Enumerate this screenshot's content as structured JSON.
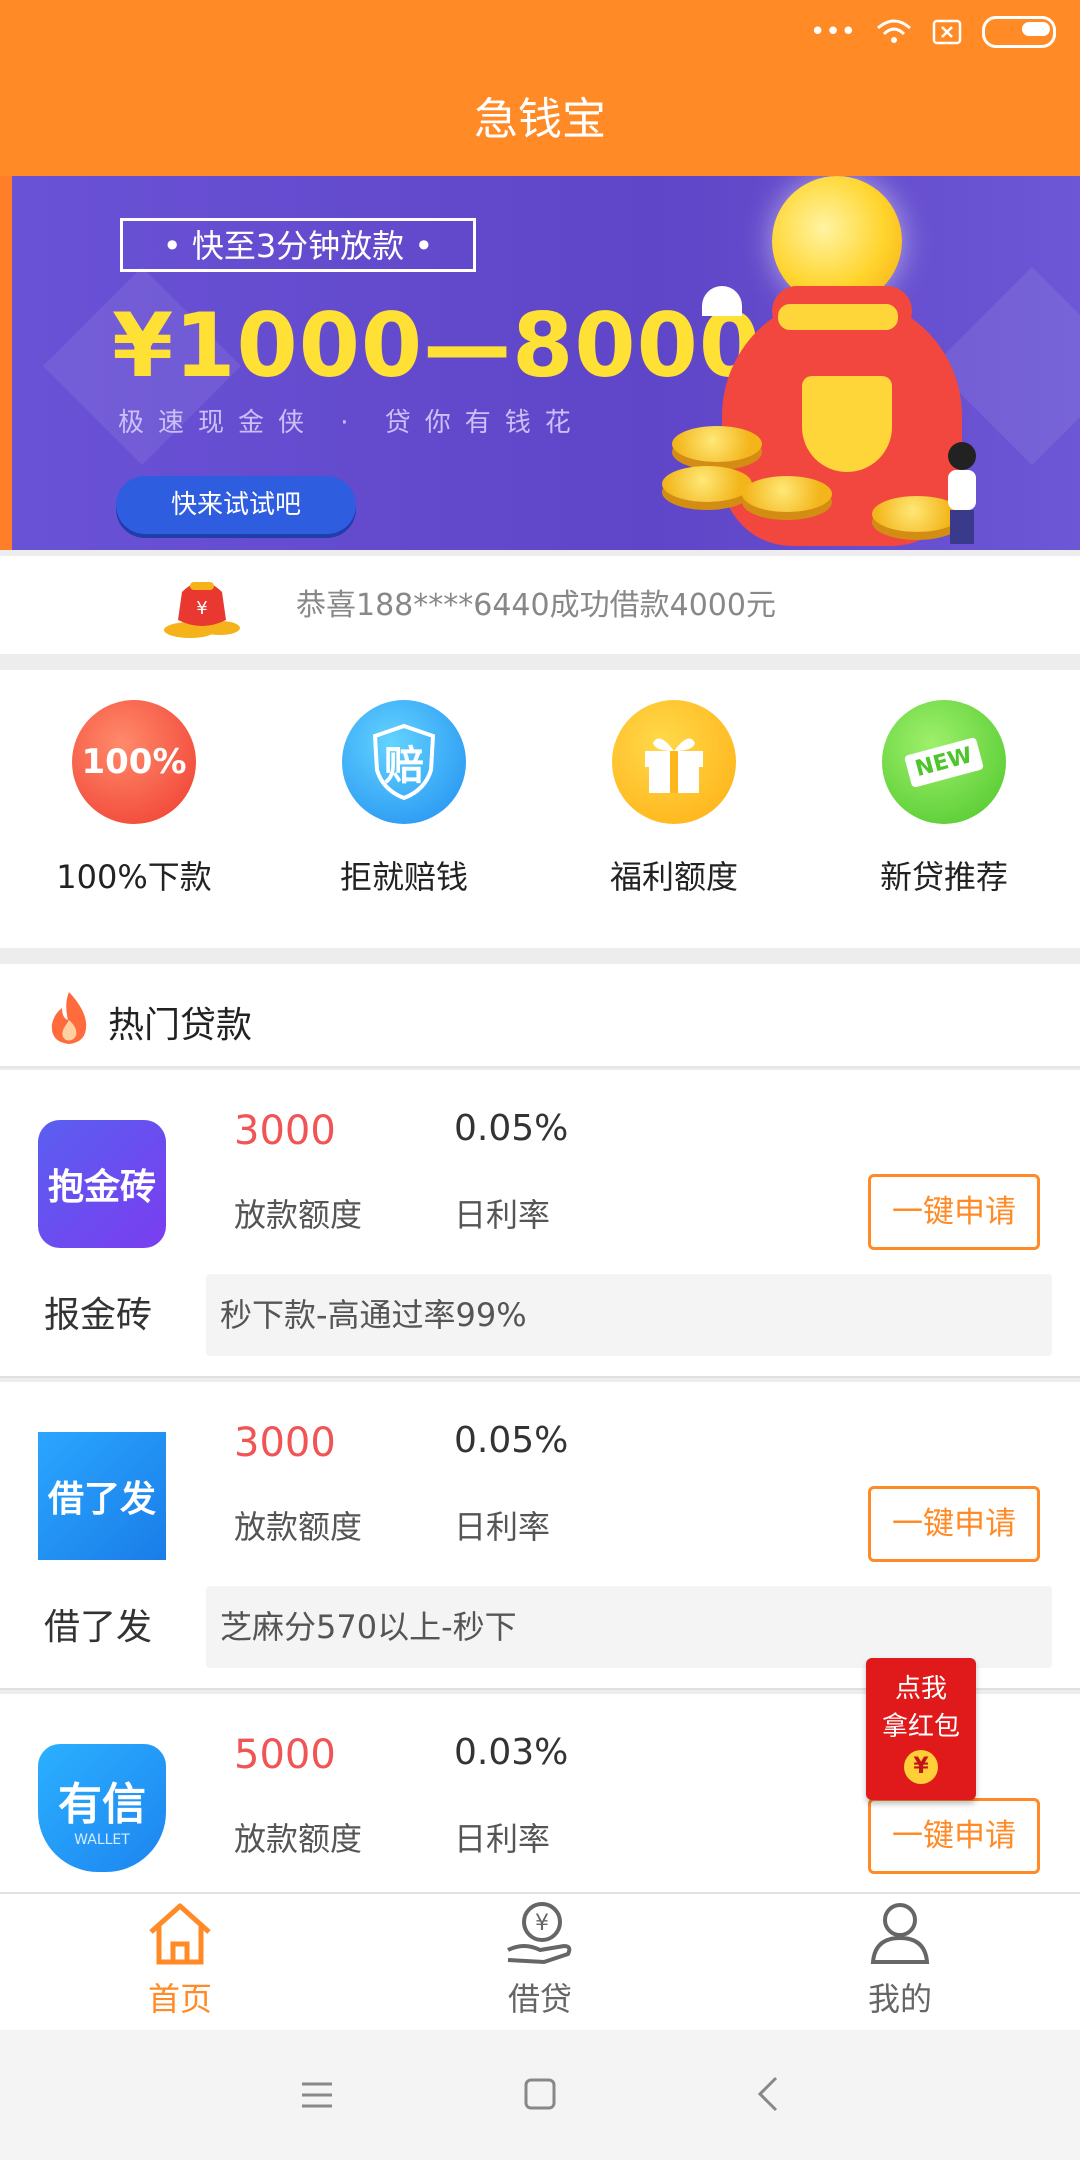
{
  "header": {
    "title": "急钱宝"
  },
  "banner": {
    "tagline": "• 快至3分钟放款 •",
    "amount": "¥1000—8000",
    "slogan": "极速现金侠 · 贷你有钱花",
    "cta": "快来试试吧"
  },
  "notice": {
    "text": "恭喜188****6440成功借款4000元"
  },
  "features": [
    {
      "label": "100%下款",
      "icon_text": "100%"
    },
    {
      "label": "拒就赔钱",
      "icon_text": "赔"
    },
    {
      "label": "福利额度"
    },
    {
      "label": "新贷推荐",
      "icon_text": "NEW"
    }
  ],
  "hot": {
    "title": "热门贷款"
  },
  "loans": [
    {
      "name": "报金砖",
      "logo_text": "抱金砖",
      "amount": "3000",
      "amount_label": "放款额度",
      "rate": "0.05%",
      "rate_label": "日利率",
      "button": "一键申请",
      "desc": "秒下款-高通过率99%"
    },
    {
      "name": "借了发",
      "logo_text": "借了发",
      "amount": "3000",
      "amount_label": "放款额度",
      "rate": "0.05%",
      "rate_label": "日利率",
      "button": "一键申请",
      "desc": "芝麻分570以上-秒下"
    },
    {
      "logo_text": "有信",
      "logo_sub": "WALLET",
      "amount": "5000",
      "amount_label": "放款额度",
      "rate": "0.03%",
      "rate_label": "日利率",
      "button": "一键申请"
    }
  ],
  "redpacket": {
    "line1": "点我",
    "line2": "拿红包",
    "yen": "¥"
  },
  "bottom_nav": [
    {
      "label": "首页",
      "icon": "home-icon",
      "active": true
    },
    {
      "label": "借贷",
      "icon": "loan-icon",
      "active": false
    },
    {
      "label": "我的",
      "icon": "user-icon",
      "active": false
    }
  ],
  "colors": {
    "primary": "#ff8a26",
    "amount": "#f05454",
    "banner": "#6a52d6"
  }
}
